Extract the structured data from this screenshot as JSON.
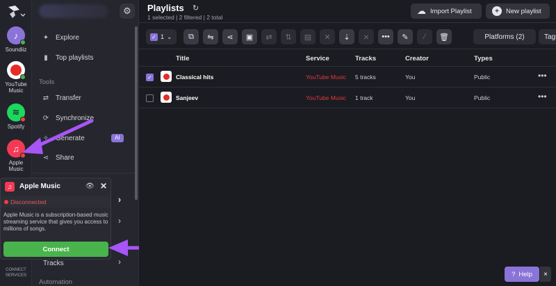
{
  "rail": {
    "services": [
      {
        "label": "Soundiiz",
        "color": "#8a74d8",
        "status": "#49b34c"
      },
      {
        "label": "YouTube Music",
        "color": "#ffffff",
        "status": "#49b34c"
      },
      {
        "label": "Spotify",
        "color": "#1ed760",
        "status": "#e44545"
      },
      {
        "label": "Apple Music",
        "color": "#f33a55",
        "status": "#e44545"
      }
    ],
    "bottom_label": "CONNECT SERVICES"
  },
  "nav": {
    "items": [
      {
        "label": "Explore",
        "icon": "compass-icon"
      },
      {
        "label": "Top playlists",
        "icon": "bar-chart-icon"
      }
    ],
    "tools_heading": "Tools",
    "tools": [
      {
        "label": "Transfer",
        "icon": "transfer-icon"
      },
      {
        "label": "Synchronize",
        "icon": "sync-icon"
      },
      {
        "label": "Generate",
        "icon": "sparkle-icon"
      },
      {
        "label": "Share",
        "icon": "share-icon"
      }
    ],
    "ai_badge": "AI",
    "tracks_label": "Tracks",
    "automation_heading": "Automation"
  },
  "popover": {
    "title": "Apple Music",
    "status": "Disconnected",
    "description": "Apple Music is a subscription-based music streaming service that gives you access to millions of songs.",
    "connect_label": "Connect"
  },
  "main": {
    "title": "Playlists",
    "subtitle": "1 selected | 2 filtered | 2 total",
    "import_label": "Import Playlist",
    "new_label": "New playlist",
    "selection_count": "1",
    "platforms_label": "Platforms (2)",
    "tags_label": "Tags",
    "columns": [
      "Title",
      "Service",
      "Tracks",
      "Creator",
      "Types"
    ],
    "rows": [
      {
        "title": "Classical hits",
        "service": "YouTube Music",
        "tracks": "5 tracks",
        "creator": "You",
        "type": "Public",
        "selected": true
      },
      {
        "title": "Sanjeev",
        "service": "YouTube Music",
        "tracks": "1 track",
        "creator": "You",
        "type": "Public",
        "selected": false
      }
    ],
    "help_label": "Help"
  },
  "colors": {
    "accent": "#8a74d8",
    "connect": "#49b34c",
    "youtube": "#e52d27",
    "disconnected": "#e44545"
  }
}
